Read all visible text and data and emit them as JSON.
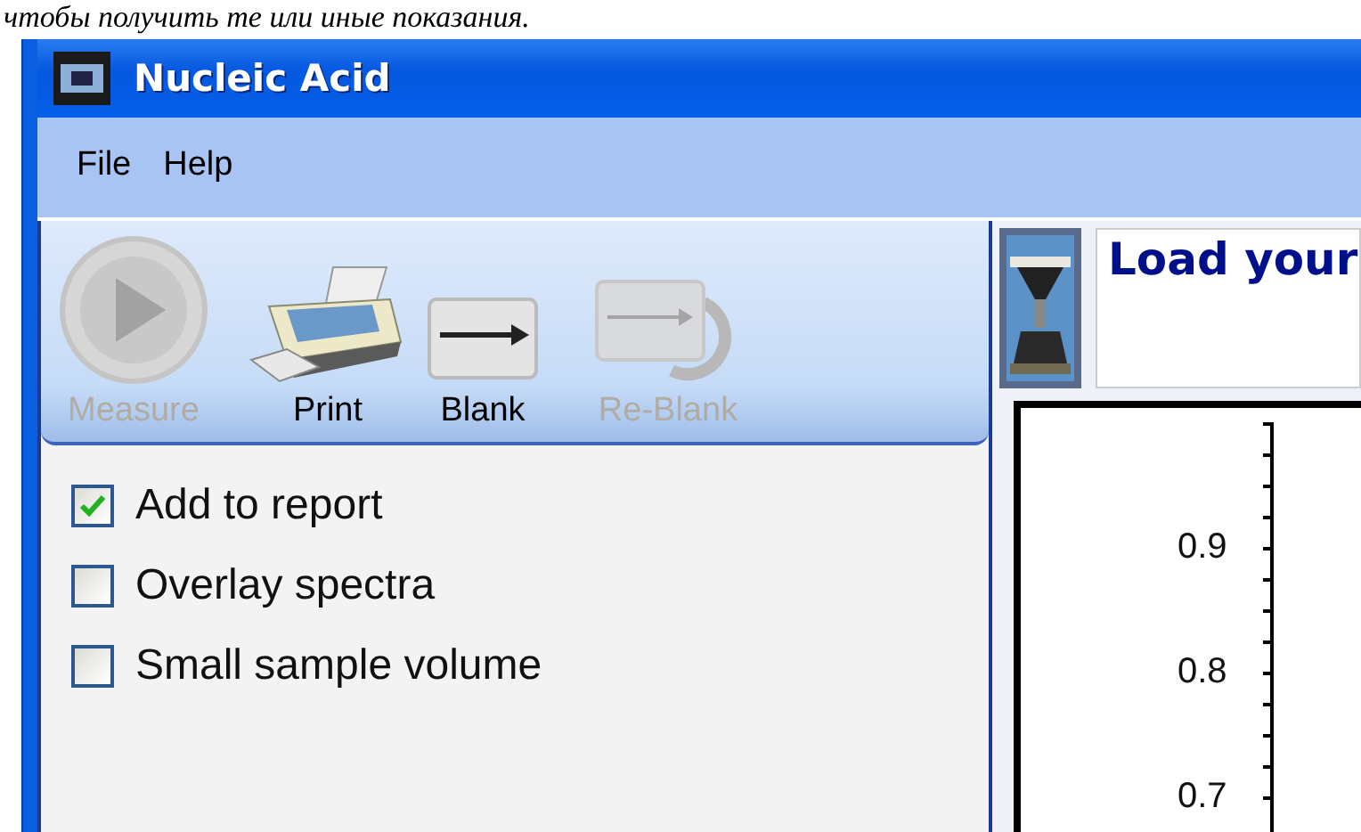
{
  "caption": "чтобы получить те или иные показания.",
  "window": {
    "title": "Nucleic Acid"
  },
  "menu": [
    "File",
    "Help"
  ],
  "toolbar": [
    {
      "label": "Measure",
      "kind": "measure",
      "disabled": true
    },
    {
      "label": "Print",
      "kind": "print",
      "disabled": false
    },
    {
      "label": "Blank",
      "kind": "blank",
      "disabled": false
    },
    {
      "label": "Re-Blank",
      "kind": "reblank",
      "disabled": true
    }
  ],
  "options": [
    {
      "label": "Add to report",
      "checked": true
    },
    {
      "label": "Overlay spectra",
      "checked": false
    },
    {
      "label": "Small sample volume",
      "checked": false
    }
  ],
  "status_message": "Load your",
  "plot": {
    "y_ticks": [
      "0.9",
      "0.8",
      "0.7"
    ]
  }
}
